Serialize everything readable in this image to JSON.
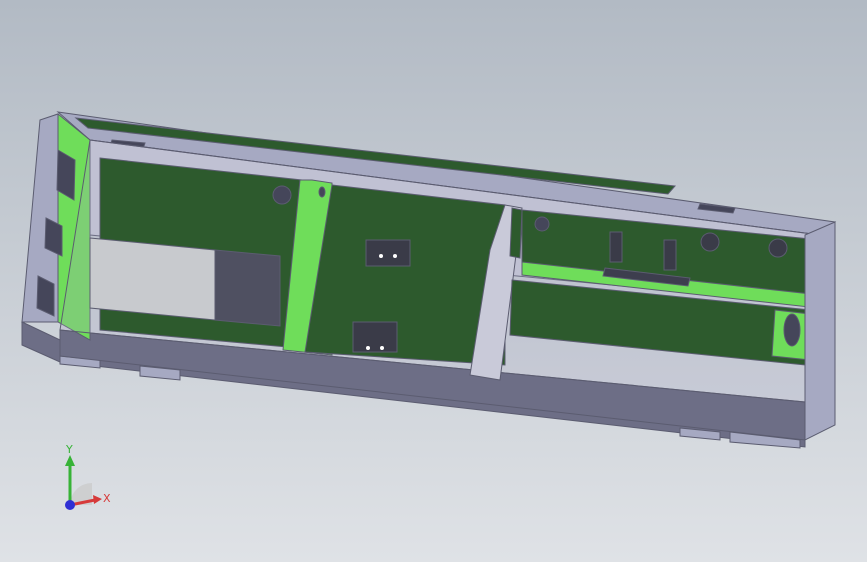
{
  "viewport": {
    "background_top": "#b2bac4",
    "background_bottom": "#dfe2e6"
  },
  "model": {
    "colors": {
      "enclosure": "#a6a9c2",
      "enclosure_dark": "#6d6e86",
      "enclosure_edge": "#5b5c70",
      "interior_wall": "#c9cad9",
      "pcb_green": "#2d5a2d",
      "pcb_green_light": "#6fdd5a",
      "rail_dark": "#3d3e4e",
      "battery_light": "#c8cace",
      "battery_dark": "#4f5061",
      "component_dark": "#3a3b48",
      "hole": "#45465a"
    }
  },
  "triad": {
    "x_label": "X",
    "y_label": "Y",
    "x_color": "#d63a3a",
    "y_color": "#37b337",
    "z_color": "#2f2fd4"
  }
}
